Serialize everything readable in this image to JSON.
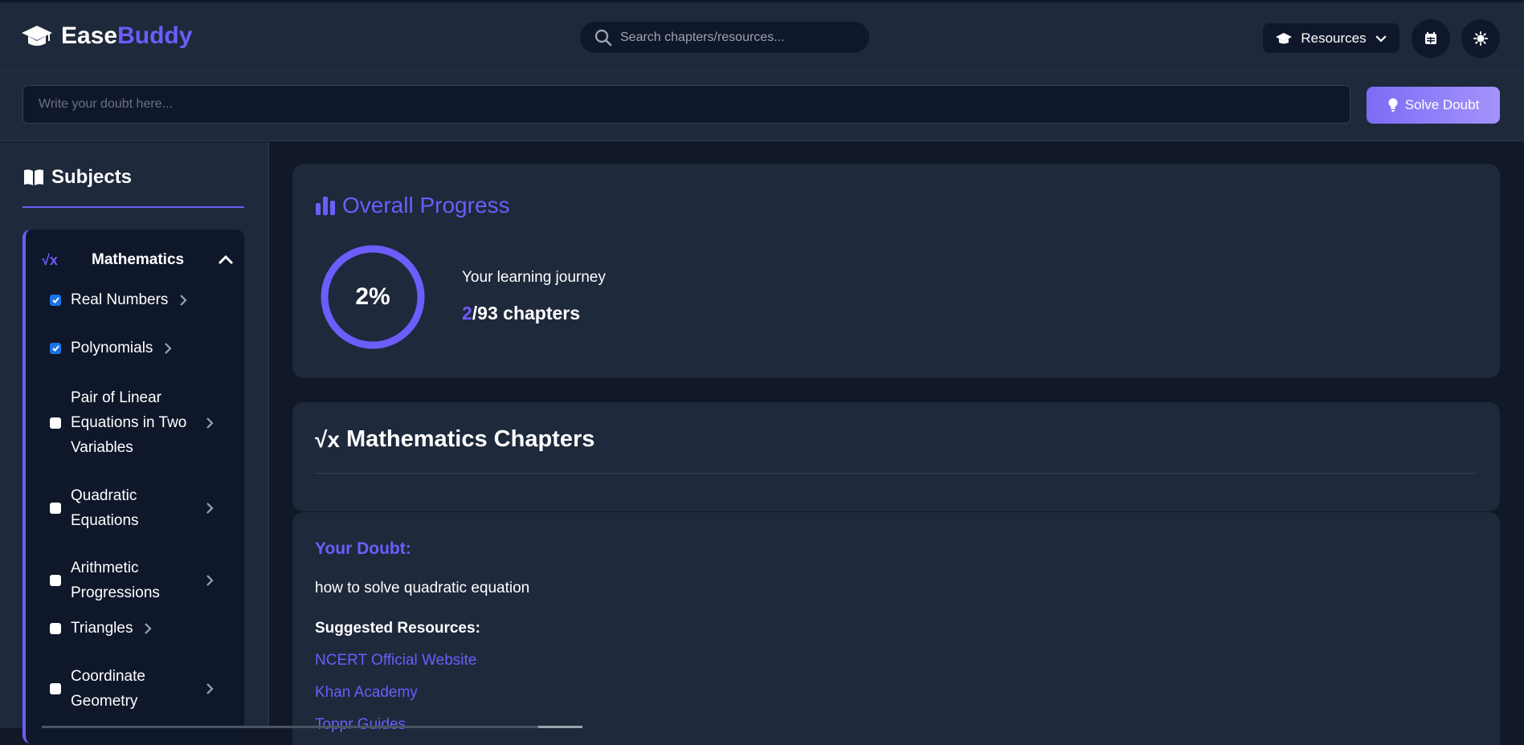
{
  "header": {
    "logo_part1": "Ease",
    "logo_part2": "Buddy",
    "logo_icon": "graduation-cap-icon",
    "search_placeholder": "Search chapters/resources...",
    "resources_label": "Resources",
    "calendar_icon": "calendar-icon",
    "theme_icon": "sun-icon"
  },
  "doubt_bar": {
    "placeholder": "Write your doubt here...",
    "solve_label": "Solve Doubt"
  },
  "sidebar": {
    "heading": "Subjects",
    "subject": {
      "symbol": "√x",
      "name": "Mathematics",
      "chapters": [
        {
          "label": "Real Numbers",
          "checked": true
        },
        {
          "label": "Polynomials",
          "checked": true
        },
        {
          "label": "Pair of Linear Equations in Two Variables",
          "checked": false
        },
        {
          "label": "Quadratic Equations",
          "checked": false
        },
        {
          "label": "Arithmetic Progressions",
          "checked": false
        },
        {
          "label": "Triangles",
          "checked": false
        },
        {
          "label": "Coordinate Geometry",
          "checked": false
        }
      ]
    }
  },
  "progress": {
    "title": "Overall Progress",
    "percent_label": "2%",
    "percent_value": 0.02,
    "journey_label": "Your learning journey",
    "completed": "2",
    "total_text": "/93 chapters"
  },
  "chapters_panel": {
    "symbol": "√x",
    "title": "Mathematics Chapters"
  },
  "doubt_result": {
    "label": "Your Doubt:",
    "question": "how to solve quadratic equation",
    "suggested_label": "Suggested Resources:",
    "resources": [
      "NCERT Official Website",
      "Khan Academy",
      "Toppr Guides"
    ]
  },
  "colors": {
    "accent": "#6d5dfc",
    "background": "#111827",
    "panel": "#1e293b",
    "checkbox_checked": "#1a73e8"
  }
}
